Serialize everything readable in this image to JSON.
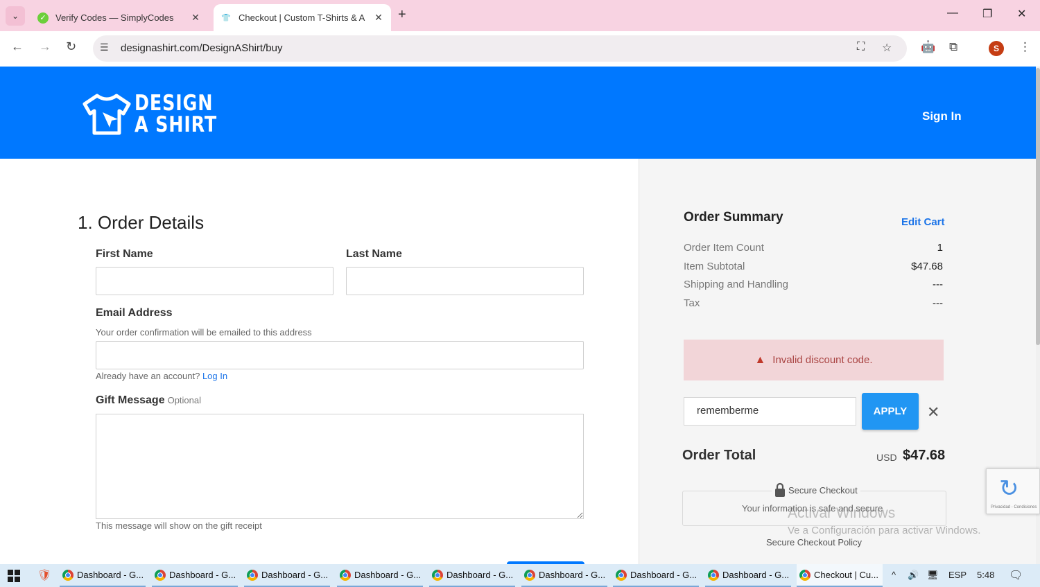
{
  "browser": {
    "tabs": [
      {
        "title": "Verify Codes — SimplyCodes",
        "active": false,
        "icon": "check-badge-icon"
      },
      {
        "title": "Checkout | Custom T-Shirts & A",
        "active": true,
        "icon": "shirt-favicon-icon"
      }
    ],
    "new_tab": "+",
    "url": "designashirt.com/DesignAShirt/buy",
    "profile_initial": "S"
  },
  "header": {
    "logo_line1": "DESIGN",
    "logo_line2": "A SHIRT",
    "sign_in": "Sign In",
    "brand_color": "#0078ff"
  },
  "order_details": {
    "title": "1. Order Details",
    "first_name_label": "First Name",
    "last_name_label": "Last Name",
    "email_label": "Email Address",
    "email_hint": "Your order confirmation will be emailed to this address",
    "account_text": "Already have an account?",
    "login_link": "Log In",
    "gift_label": "Gift Message",
    "gift_optional": "Optional",
    "gift_hint": "This message will show on the gift receipt"
  },
  "summary": {
    "title": "Order Summary",
    "edit_cart": "Edit Cart",
    "rows": [
      {
        "label": "Order Item Count",
        "value": "1"
      },
      {
        "label": "Item Subtotal",
        "value": "$47.68"
      },
      {
        "label": "Shipping and Handling",
        "value": "---"
      },
      {
        "label": "Tax",
        "value": "---"
      }
    ],
    "alert": "Invalid discount code.",
    "discount_code": "rememberme",
    "apply": "APPLY",
    "total_label": "Order Total",
    "currency": "USD",
    "total_value": "$47.68",
    "secure_title": "Secure Checkout",
    "secure_msg": "Your information is safe and secure",
    "secure_policy": "Secure Checkout Policy",
    "recaptcha_text": "Privacidad - Condiciones"
  },
  "watermark": {
    "line1": "Activar Windows",
    "line2": "Ve a Configuración para activar Windows."
  },
  "taskbar": {
    "items": [
      {
        "label": "Dashboard - G..."
      },
      {
        "label": "Dashboard - G..."
      },
      {
        "label": "Dashboard - G..."
      },
      {
        "label": "Dashboard - G..."
      },
      {
        "label": "Dashboard - G..."
      },
      {
        "label": "Dashboard - G..."
      },
      {
        "label": "Dashboard - G..."
      },
      {
        "label": "Dashboard - G..."
      },
      {
        "label": "Checkout | Cu..."
      }
    ],
    "lang": "ESP",
    "time": "5:48"
  }
}
